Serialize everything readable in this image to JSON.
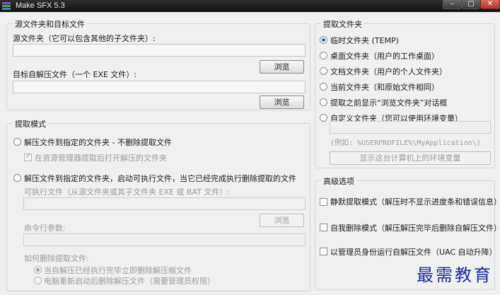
{
  "window": {
    "title": "Make SFX 5.3"
  },
  "source_group": {
    "legend": "源文件夹和目标文件",
    "source_label": "源文件夹（它可以包含其他的子文件夹）:",
    "source_value": "",
    "target_label": "目标自解压文件（一个 EXE 文件）:",
    "target_value": "",
    "browse_label": "浏览"
  },
  "mode_group": {
    "legend": "提取模式",
    "opt1_label": "解压文件到指定的文件夹 - 不删除提取文件",
    "opt1_sub_checkbox": "在资源管理器提取后打开解压的文件夹",
    "opt2_label": "解压文件到指定的文件夹，启动可执行文件，当它已经完成执行删除提取的文件",
    "exe_label": "可执行文件（从源文件夹或其子文件夹 EXE 或 BAT 文件）:",
    "exe_value": "",
    "browse_label": "浏览",
    "cmd_label": "命令行参数:",
    "cmd_value": "",
    "delete_label": "如何删除提取文件:",
    "delete_opt1": "当自解压已经执行完毕立即删除解压缩文件",
    "delete_opt2": "电脑重新启动后删除解压文件（需要管理员权限）"
  },
  "extract_group": {
    "legend": "提取文件夹",
    "options": [
      "临时文件夹 (TEMP)",
      "桌面文件夹（用户的工作桌面）",
      "文档文件夹（用户的个人文件夹）",
      "当前文件夹（和原始文件相同）",
      "提取之前显示“浏览文件夹”对话框",
      "自定义文件夹（您可以使用环境变量）"
    ],
    "custom_value": "",
    "example_text": "(例如: %USERPROFILE%\\MyApplication\\)",
    "show_env_button": "显示这台计算机上的环境变量"
  },
  "advanced_group": {
    "legend": "高级选项",
    "options": [
      "静默提取模式（解压时不显示进度条和错误信息）",
      "自我删除模式（解压解压完毕后删除自解压文件）",
      "以管理员身份运行自解压文件（UAC 自动升降）"
    ]
  },
  "watermark": "最需教育"
}
